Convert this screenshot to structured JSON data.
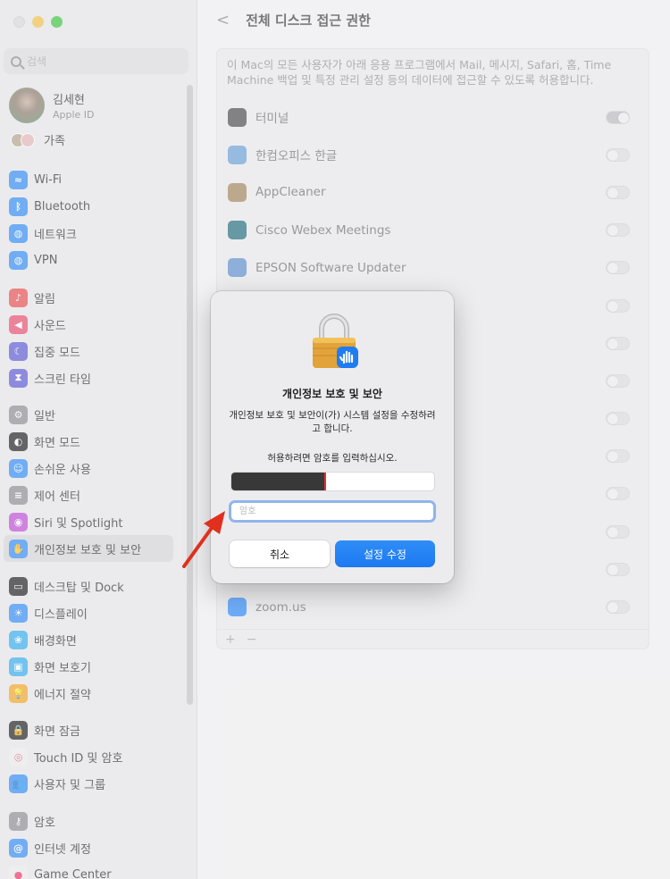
{
  "sidebar": {
    "search_placeholder": "검색",
    "profile": {
      "name": "김세현",
      "subtitle": "Apple ID"
    },
    "family_label": "가족",
    "groups": [
      {
        "items": [
          {
            "id": "wifi",
            "label": "Wi-Fi",
            "color": "#2f8df7",
            "glyph": "≈"
          },
          {
            "id": "bluetooth",
            "label": "Bluetooth",
            "color": "#2f8df7",
            "glyph": "ᛒ"
          },
          {
            "id": "network",
            "label": "네트워크",
            "color": "#2f8df7",
            "glyph": "◍"
          },
          {
            "id": "vpn",
            "label": "VPN",
            "color": "#2f8df7",
            "glyph": "◍"
          }
        ]
      },
      {
        "items": [
          {
            "id": "notifications",
            "label": "알림",
            "color": "#eb4d4d",
            "glyph": "♪"
          },
          {
            "id": "sound",
            "label": "사운드",
            "color": "#eb4d6e",
            "glyph": "◀"
          },
          {
            "id": "focus",
            "label": "집중 모드",
            "color": "#5b58d6",
            "glyph": "☾"
          },
          {
            "id": "screentime",
            "label": "스크린 타임",
            "color": "#5b58d6",
            "glyph": "⧗"
          }
        ]
      },
      {
        "items": [
          {
            "id": "general",
            "label": "일반",
            "color": "#8e8d92",
            "glyph": "⚙"
          },
          {
            "id": "appearance",
            "label": "화면 모드",
            "color": "#1d1d1f",
            "glyph": "◐"
          },
          {
            "id": "accessibility",
            "label": "손쉬운 사용",
            "color": "#2f8df7",
            "glyph": "☺"
          },
          {
            "id": "controlcenter",
            "label": "제어 센터",
            "color": "#8e8d92",
            "glyph": "≡"
          },
          {
            "id": "siri",
            "label": "Siri 및 Spotlight",
            "color": "#c24bd8",
            "glyph": "◉"
          },
          {
            "id": "privacy",
            "label": "개인정보 보호 및 보안",
            "color": "#2f8df7",
            "glyph": "✋",
            "selected": true
          }
        ]
      },
      {
        "items": [
          {
            "id": "desktop",
            "label": "데스크탑 및 Dock",
            "color": "#1d1d1f",
            "glyph": "▭"
          },
          {
            "id": "displays",
            "label": "디스플레이",
            "color": "#2f8df7",
            "glyph": "☀"
          },
          {
            "id": "wallpaper",
            "label": "배경화면",
            "color": "#32aef0",
            "glyph": "❀"
          },
          {
            "id": "screensaver",
            "label": "화면 보호기",
            "color": "#32aef0",
            "glyph": "▣"
          },
          {
            "id": "battery",
            "label": "에너지 절약",
            "color": "#f5a623",
            "glyph": "💡"
          }
        ]
      },
      {
        "items": [
          {
            "id": "lockscreen",
            "label": "화면 잠금",
            "color": "#1d1d1f",
            "glyph": "🔒"
          },
          {
            "id": "touchid",
            "label": "Touch ID 및 암호",
            "color": "#f0f0f0",
            "glyph": "◎",
            "glyph_color": "#e45a6b"
          },
          {
            "id": "users",
            "label": "사용자 및 그룹",
            "color": "#2f8df7",
            "glyph": "👥"
          }
        ]
      },
      {
        "items": [
          {
            "id": "passwords",
            "label": "암호",
            "color": "#8e8d92",
            "glyph": "⚷"
          },
          {
            "id": "internetaccounts",
            "label": "인터넷 계정",
            "color": "#2f8df7",
            "glyph": "@"
          },
          {
            "id": "gamecenter",
            "label": "Game Center",
            "color": "#f0f0f0",
            "glyph": "●",
            "glyph_color": "#e36"
          }
        ]
      }
    ]
  },
  "main": {
    "back_label": "<",
    "title": "전체 디스크 접근 권한",
    "description": "이 Mac의 모든 사용자가 아래 응용 프로그램에서 Mail, 메시지, Safari, 홈, Time Machine 백업 및 특정 관리 설정 등의 데이터에 접근할 수 있도록 허용합니다.",
    "apps": [
      {
        "name": "터미널",
        "on": true,
        "color": "#4a4a4c"
      },
      {
        "name": "한컴오피스 한글",
        "on": false,
        "color": "#6aa1d9"
      },
      {
        "name": "AppCleaner",
        "on": false,
        "color": "#a3865a"
      },
      {
        "name": "Cisco Webex Meetings",
        "on": false,
        "color": "#1f6d7c"
      },
      {
        "name": "EPSON Software Updater",
        "on": false,
        "color": "#5b8fcf"
      },
      {
        "name": "",
        "on": false,
        "color": "transparent"
      },
      {
        "name": "",
        "on": false,
        "color": "transparent"
      },
      {
        "name": "",
        "on": false,
        "color": "transparent"
      },
      {
        "name": "",
        "on": false,
        "color": "transparent"
      },
      {
        "name": "",
        "on": false,
        "color": "transparent"
      },
      {
        "name": "",
        "on": false,
        "color": "transparent"
      },
      {
        "name": "",
        "on": false,
        "color": "transparent"
      },
      {
        "name": "",
        "on": false,
        "color": "transparent"
      },
      {
        "name": "zoom.us",
        "on": false,
        "color": "#2d8cff"
      }
    ],
    "add_label": "+",
    "remove_label": "−"
  },
  "dialog": {
    "title": "개인정보 보호 및 보안",
    "message": "개인정보 보호 및 보안이(가) 시스템 설정을 수정하려고 합니다.",
    "hint": "허용하려면 암호를 입력하십시오.",
    "password_placeholder": "암호",
    "cancel_label": "취소",
    "ok_label": "설정 수정"
  },
  "colors": {
    "accent": "#1d79f2",
    "arrow": "#e0301e"
  }
}
